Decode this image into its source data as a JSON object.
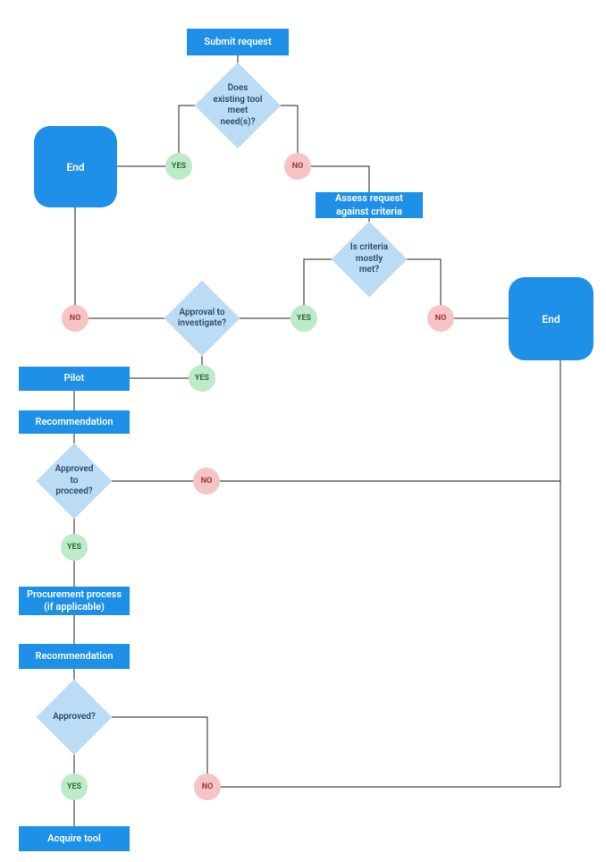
{
  "nodes": {
    "submit": {
      "label": "Submit request"
    },
    "existing": {
      "label": "Does existing tool meet need(s)?"
    },
    "end1": {
      "label": "End"
    },
    "assess": {
      "label": "Assess request against criteria"
    },
    "criteria": {
      "label": "Is criteria mostly met?"
    },
    "approvalInv": {
      "label": "Approval to investigate?"
    },
    "end2": {
      "label": "End"
    },
    "pilot": {
      "label": "Pilot"
    },
    "rec1": {
      "label": "Recommendation"
    },
    "appProceed": {
      "label": "Approved to proceed?"
    },
    "procure": {
      "label": "Procurement process (if applicable)"
    },
    "rec2": {
      "label": "Recommendation"
    },
    "approved": {
      "label": "Approved?"
    },
    "acquire": {
      "label": "Acquire tool"
    }
  },
  "tags": {
    "yes": "YES",
    "no": "NO"
  }
}
